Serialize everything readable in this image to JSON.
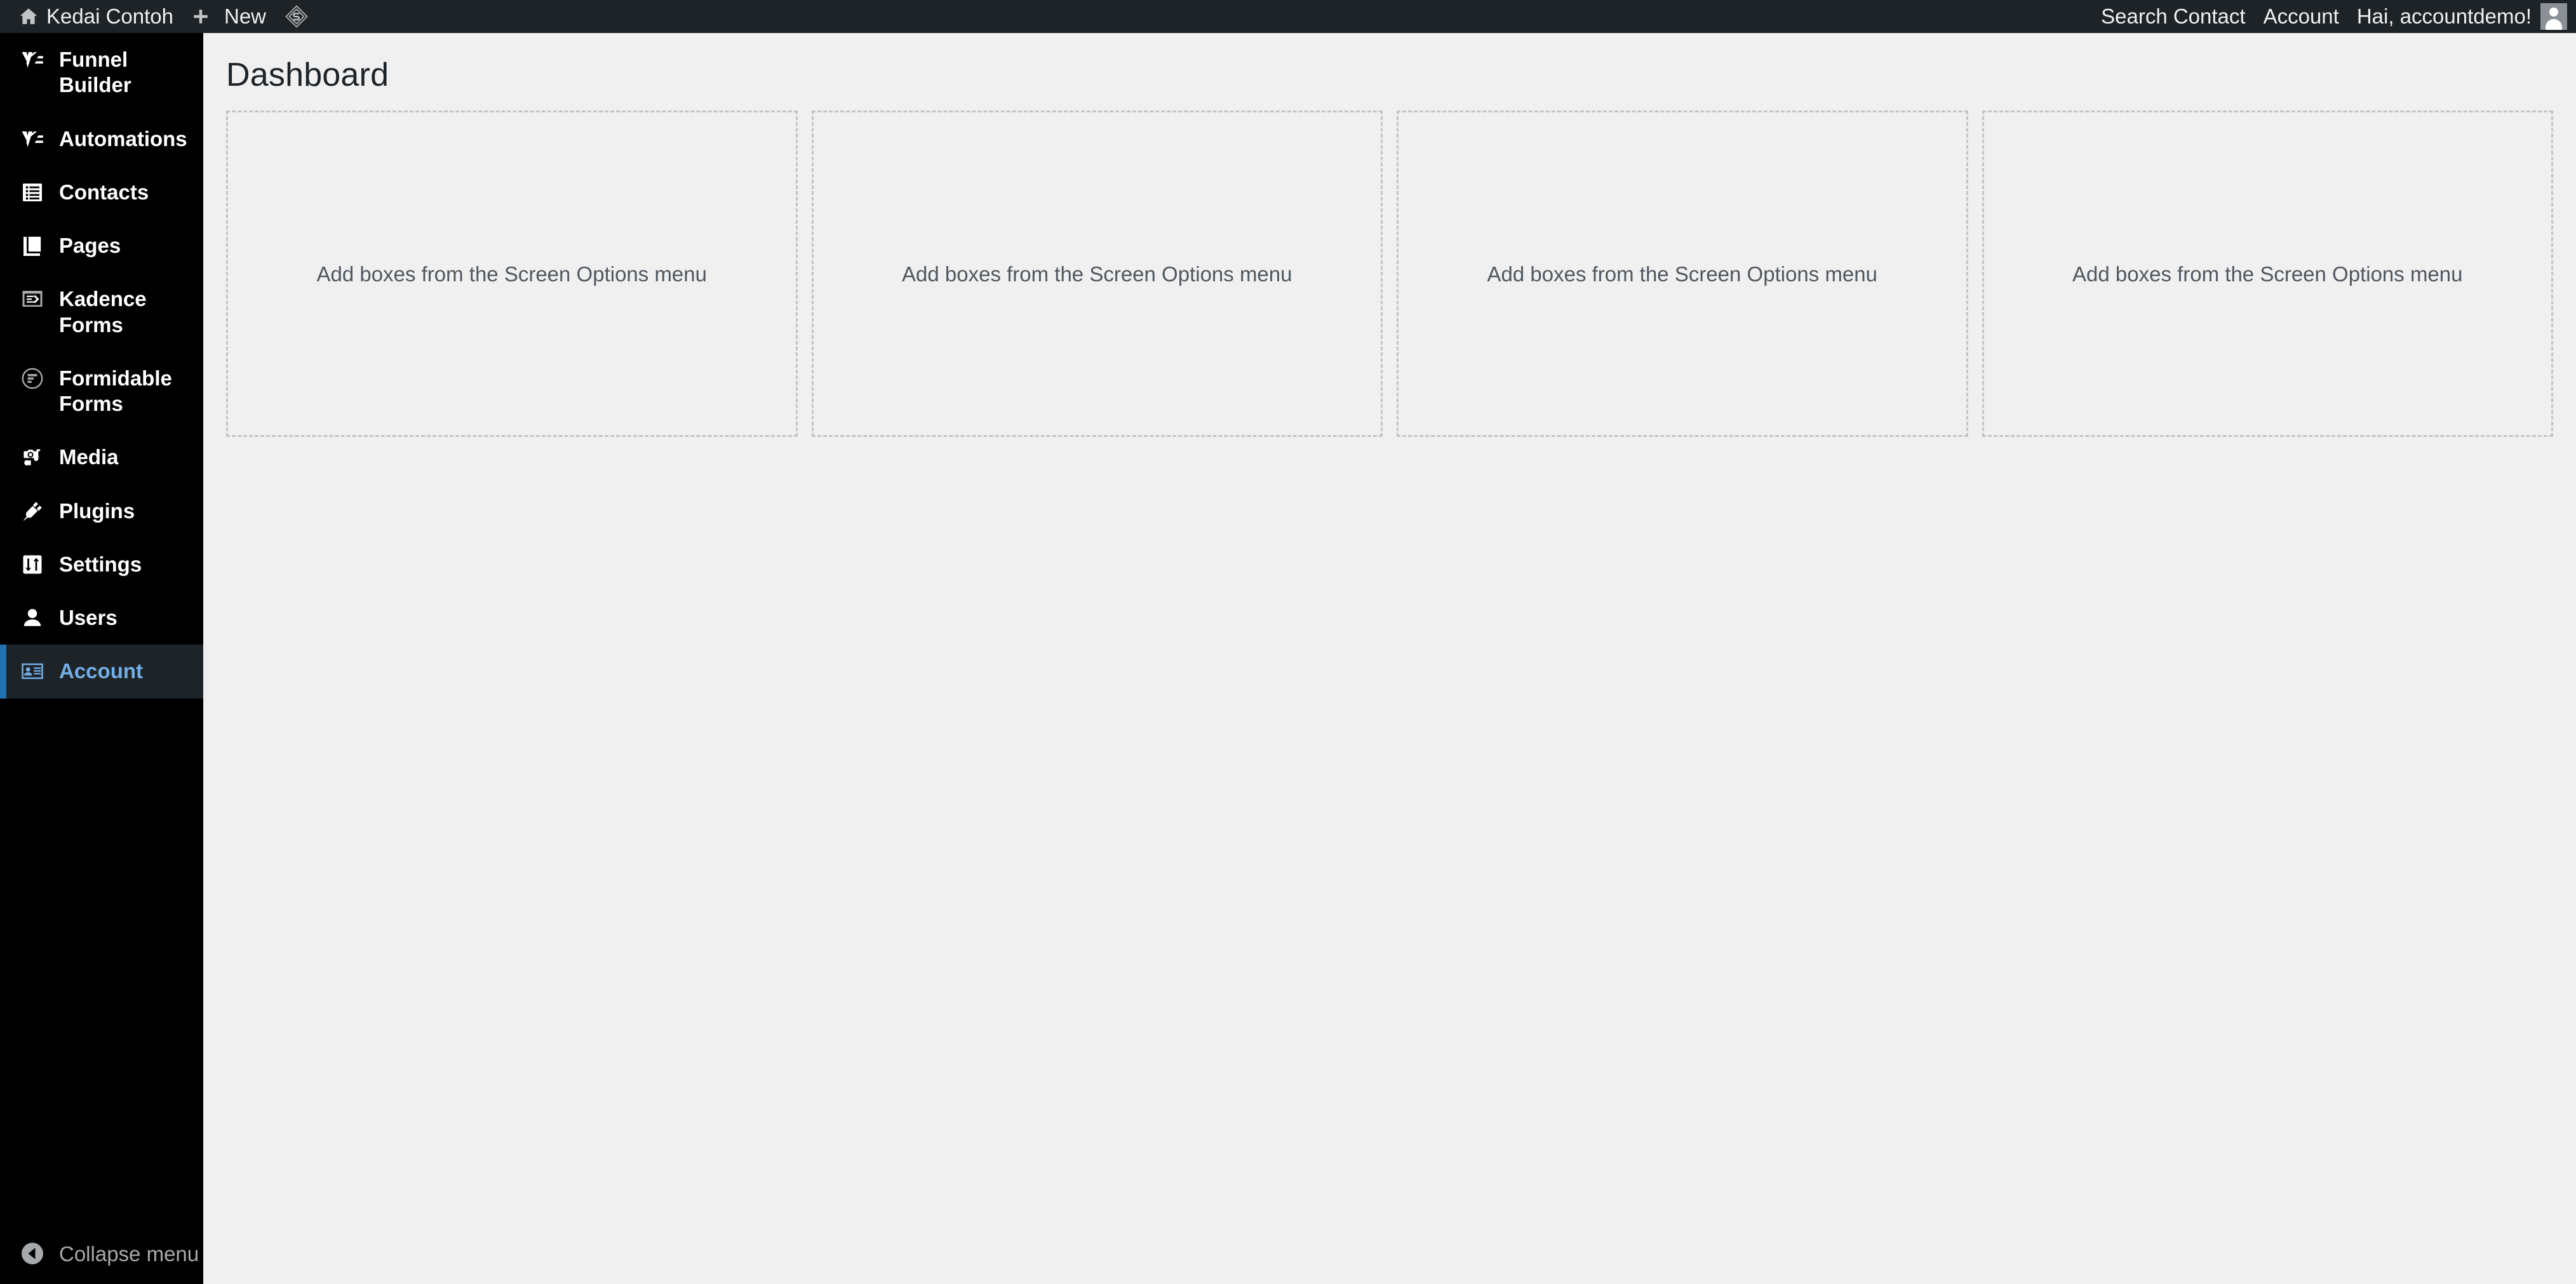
{
  "admin_bar": {
    "left_items": [
      {
        "id": "site-name",
        "label": "Kedai Contoh",
        "icon": "home-icon"
      },
      {
        "id": "new-content",
        "label": "New",
        "icon": "plus-icon"
      },
      {
        "id": "plugin-badge",
        "label": "",
        "icon": "diamond-icon"
      }
    ],
    "right_items": [
      {
        "id": "search-contact",
        "label": "Search Contact"
      },
      {
        "id": "account",
        "label": "Account"
      },
      {
        "id": "howdy",
        "label": "Hai, accountdemo!"
      }
    ],
    "avatar_alt": "avatar",
    "background_color": "#1d2327",
    "text_color": "#f0f0f1"
  },
  "sidebar": {
    "background_color": "#000000",
    "active_background_color": "#1d2327",
    "active_accent_color": "#2271b1",
    "active_text_color": "#72aee6",
    "items": [
      {
        "id": "funnel-builder",
        "label": "Funnel Builder",
        "icon": "funnel-builder-icon",
        "active": false
      },
      {
        "id": "automations",
        "label": "Automations",
        "icon": "automations-icon",
        "active": false
      },
      {
        "id": "contacts",
        "label": "Contacts",
        "icon": "contacts-icon",
        "active": false
      },
      {
        "id": "pages",
        "label": "Pages",
        "icon": "pages-icon",
        "active": false
      },
      {
        "id": "kadence-forms",
        "label": "Kadence Forms",
        "icon": "kadence-forms-icon",
        "active": false
      },
      {
        "id": "formidable-forms",
        "label": "Formidable Forms",
        "icon": "formidable-forms-icon",
        "active": false
      },
      {
        "id": "media",
        "label": "Media",
        "icon": "media-icon",
        "active": false
      },
      {
        "id": "plugins",
        "label": "Plugins",
        "icon": "plugins-icon",
        "active": false
      },
      {
        "id": "settings",
        "label": "Settings",
        "icon": "settings-icon",
        "active": false
      },
      {
        "id": "users",
        "label": "Users",
        "icon": "users-icon",
        "active": false
      },
      {
        "id": "account",
        "label": "Account",
        "icon": "account-card-icon",
        "active": true
      }
    ],
    "collapse": {
      "label": "Collapse menu",
      "icon": "collapse-arrow-icon"
    }
  },
  "main": {
    "background_color": "#f0f0f1",
    "page_title": "Dashboard",
    "empty_message": "Add boxes from the Screen Options menu",
    "columns": [
      {
        "id": "col-1",
        "empty_text": "Add boxes from the Screen Options menu"
      },
      {
        "id": "col-2",
        "empty_text": "Add boxes from the Screen Options menu"
      },
      {
        "id": "col-3",
        "empty_text": "Add boxes from the Screen Options menu"
      },
      {
        "id": "col-4",
        "empty_text": "Add boxes from the Screen Options menu"
      }
    ],
    "placeholder_border_color": "#c3c4c7"
  }
}
